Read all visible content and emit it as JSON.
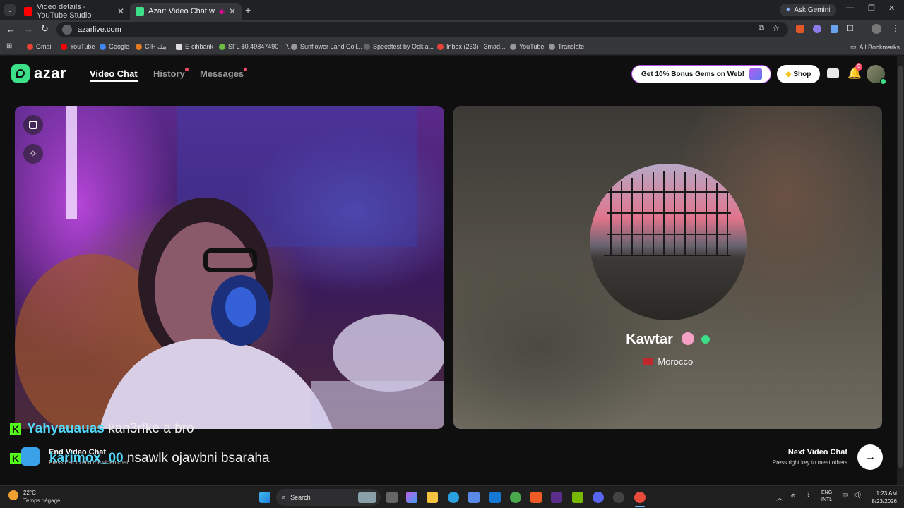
{
  "browser": {
    "tabs": [
      {
        "title": "Video details - YouTube Studio",
        "favicon_color": "#ff0000"
      },
      {
        "title": "Azar: Video Chat with New",
        "favicon_color": "#3ce089"
      }
    ],
    "ask_gemini": "Ask Gemini",
    "url": "azarlive.com",
    "bookmarks": [
      {
        "label": "Gmail",
        "color": "#ea4335"
      },
      {
        "label": "YouTube",
        "color": "#ff0000"
      },
      {
        "label": "Google",
        "color": "#4285f4"
      },
      {
        "label": "CIH بنك |",
        "color": "#e07a20"
      },
      {
        "label": "E-cihbank",
        "color": "#333"
      },
      {
        "label": "SFL $0.49847490 - P...",
        "color": "#6dbd45"
      },
      {
        "label": "Sunflower Land Coll...",
        "color": "#999"
      },
      {
        "label": "Speedtest by Ookla...",
        "color": "#444"
      },
      {
        "label": "Inbox (233) - 3mad...",
        "color": "#ea4335"
      },
      {
        "label": "YouTube",
        "color": "#999"
      },
      {
        "label": "Translate",
        "color": "#999"
      }
    ],
    "all_bookmarks": "All Bookmarks"
  },
  "app": {
    "logo": "azar",
    "nav": {
      "video_chat": "Video Chat",
      "history": "History",
      "messages": "Messages"
    },
    "promo": "Get 10% Bonus Gems on Web!",
    "shop": "Shop",
    "notification_badge": "9"
  },
  "partner": {
    "name": "Kawtar",
    "country": "Morocco"
  },
  "chat": [
    {
      "user": "Yahyauauas",
      "message": "kan3rfke a bro"
    },
    {
      "user": "karimox_00",
      "message": "nsawlk ojawbni bsaraha"
    }
  ],
  "controls": {
    "end_title": "End Video Chat",
    "end_hint": "Press Esc to end the video chat",
    "next_title": "Next Video Chat",
    "next_hint": "Press right key to meet others"
  },
  "taskbar": {
    "temperature": "22°C",
    "weather": "Temps dégagé",
    "search": "Search",
    "lang": "ENG",
    "layout": "INTL",
    "time": "1:23 AM",
    "date": "8/23/2026"
  }
}
